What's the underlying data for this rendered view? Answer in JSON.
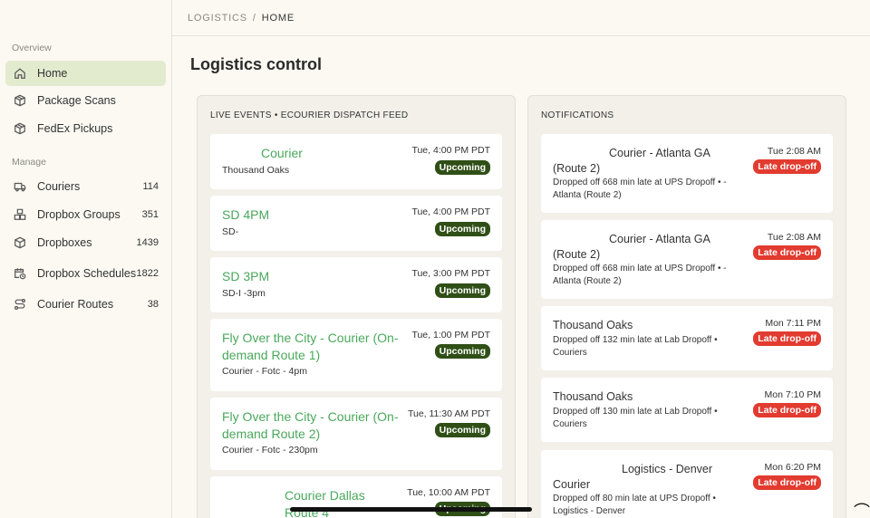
{
  "breadcrumb": {
    "section": "LOGISTICS",
    "separator": "/",
    "current": "HOME"
  },
  "page": {
    "title": "Logistics control"
  },
  "sidebar": {
    "overview_label": "Overview",
    "manage_label": "Manage",
    "overview_items": [
      {
        "label": "Home",
        "icon": "home-icon",
        "active": true
      },
      {
        "label": "Package Scans",
        "icon": "package-icon"
      },
      {
        "label": "FedEx Pickups",
        "icon": "package-icon"
      }
    ],
    "manage_items": [
      {
        "label": "Couriers",
        "count": "114",
        "icon": "truck-icon"
      },
      {
        "label": "Dropbox Groups",
        "count": "351",
        "icon": "boxes-icon"
      },
      {
        "label": "Dropboxes",
        "count": "1439",
        "icon": "box-icon"
      },
      {
        "label": "Dropbox Schedules",
        "count": "1822",
        "icon": "calendar-clock-icon"
      },
      {
        "label": "Courier Routes",
        "count": "38",
        "icon": "route-icon"
      }
    ]
  },
  "events": {
    "title": "LIVE EVENTS • ECOURIER DISPATCH FEED",
    "items": [
      {
        "title": "Courier",
        "subtitle": "Thousand Oaks",
        "time": "Tue, 4:00 PM PDT",
        "status": "Upcoming"
      },
      {
        "title": "SD 4PM",
        "subtitle": "SD-",
        "time": "Tue, 4:00 PM PDT",
        "status": "Upcoming"
      },
      {
        "title": "SD 3PM",
        "subtitle": "SD-I -3pm",
        "time": "Tue, 3:00 PM PDT",
        "status": "Upcoming"
      },
      {
        "title": "Fly Over the City - Courier (On-demand Route 1)",
        "subtitle": "Courier - Fotc - 4pm",
        "time": "Tue, 1:00 PM PDT",
        "status": "Upcoming"
      },
      {
        "title": "Fly Over the City - Courier (On-demand Route 2)",
        "subtitle": "Courier - Fotc - 230pm",
        "time": "Tue, 11:30 AM PDT",
        "status": "Upcoming"
      },
      {
        "title": "Courier Dallas Route 4",
        "subtitle": "",
        "time": "Tue, 10:00 AM PDT",
        "status": "Upcoming"
      }
    ]
  },
  "notifications": {
    "title": "NOTIFICATIONS",
    "items": [
      {
        "title": "Courier - Atlanta GA (Route 2)",
        "detail": "Dropped off 668 min late at UPS Dropoff • - Atlanta (Route 2)",
        "time": "Tue 2:08 AM",
        "status": "Late drop-off"
      },
      {
        "title": "Courier - Atlanta GA (Route 2)",
        "detail": "Dropped off 668 min late at UPS Dropoff • - Atlanta (Route 2)",
        "time": "Tue 2:08 AM",
        "status": "Late drop-off"
      },
      {
        "title": "Thousand Oaks",
        "detail": "Dropped off 132 min late at Lab Dropoff • Couriers",
        "time": "Mon 7:11 PM",
        "status": "Late drop-off"
      },
      {
        "title": "Thousand Oaks",
        "detail": "Dropped off 130 min late at Lab Dropoff • Couriers",
        "time": "Mon 7:10 PM",
        "status": "Late drop-off"
      },
      {
        "title": "Logistics - Denver Courier",
        "detail": "Dropped off 80 min late at UPS Dropoff • Logistics - Denver",
        "time": "Mon 6:20 PM",
        "status": "Late drop-off"
      }
    ]
  },
  "colors": {
    "accent_green": "#4aa85c",
    "upcoming_badge": "#2f4f17",
    "late_badge": "#e23b30",
    "active_nav": "#e3ebcf"
  }
}
